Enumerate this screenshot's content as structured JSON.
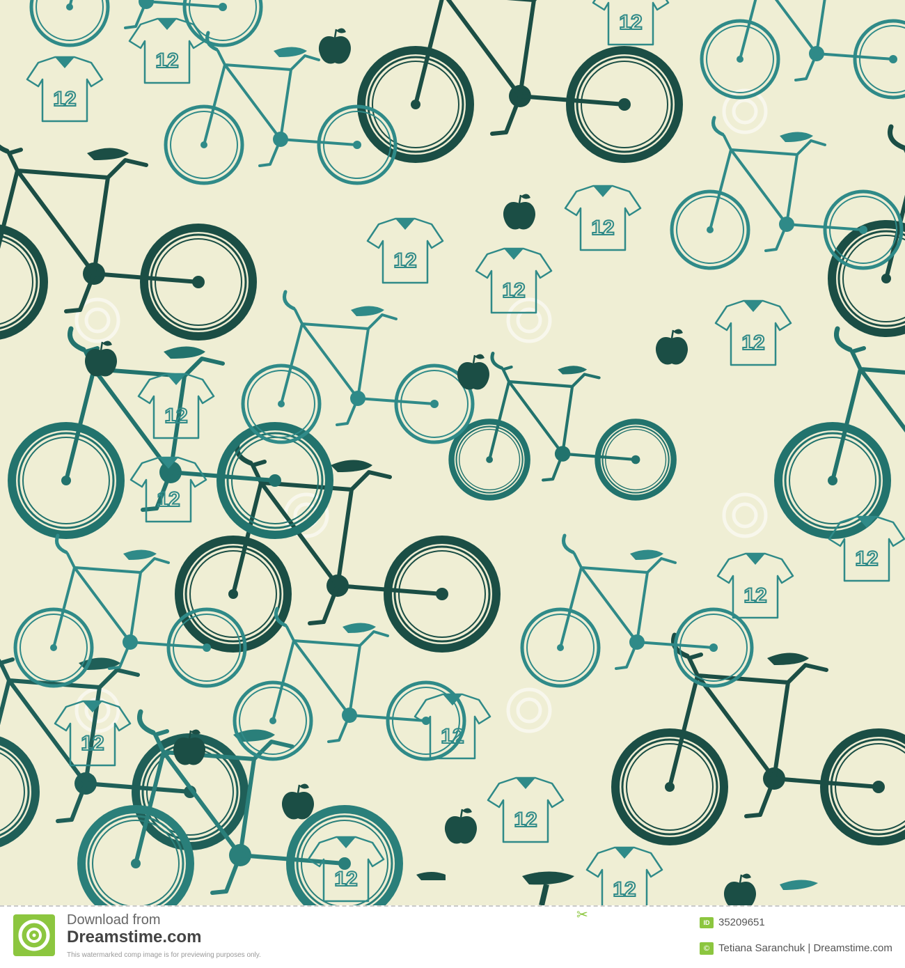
{
  "pattern": {
    "background": "#efeed4",
    "colors": {
      "dark": "#1b4e45",
      "mid": "#22736d",
      "light": "#2f8a88"
    },
    "motifs": [
      "bicycle-icon",
      "t-shirt-icon",
      "apple-icon",
      "swirl-watermark-icon"
    ],
    "shirt_number": "12",
    "watermark_text": "dreamstime"
  },
  "footer": {
    "download_label": "Download from",
    "site_name": "Dreamstime.com",
    "note": "This watermarked comp image is for previewing purposes only.",
    "id_badge": "ID",
    "image_id": "35209651",
    "copyright_symbol": "©",
    "credit": "Tetiana Saranchuk | Dreamstime.com",
    "accent": "#8cc63f"
  }
}
